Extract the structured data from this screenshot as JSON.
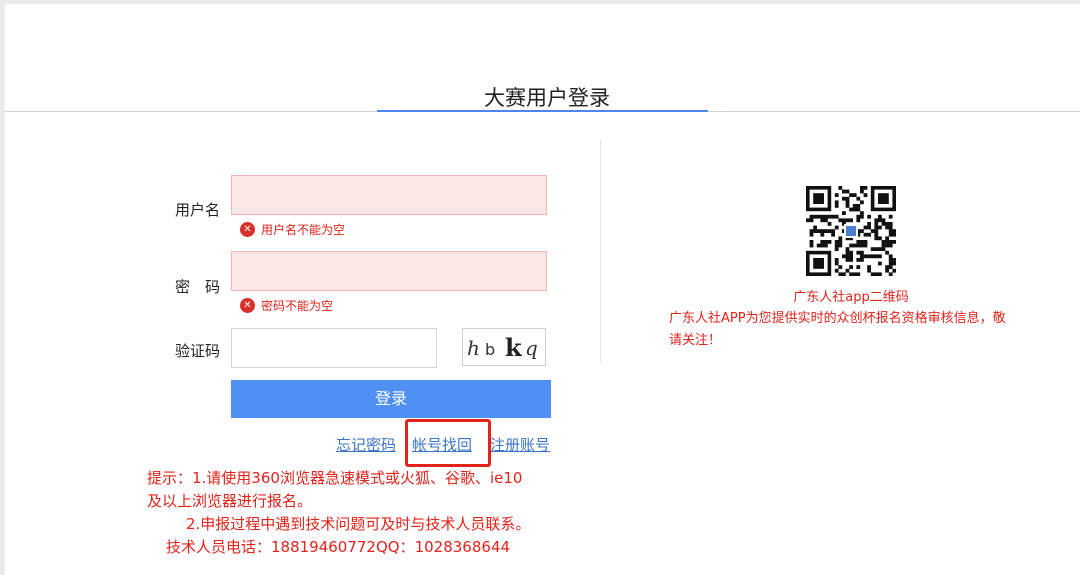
{
  "page_title": "大赛用户登录",
  "form": {
    "username_label": "用户名",
    "username_error": "用户名不能为空",
    "password_label": "密　码",
    "password_error": "密码不能为空",
    "captcha_label": "验证码",
    "captcha_text": "hbkq",
    "error_icon": "error-x-icon",
    "login_button": "登录"
  },
  "links": {
    "forgot_password": "忘记密码",
    "recover_account": "帐号找回",
    "register": "注册账号"
  },
  "tips": {
    "line1": "提示：1.请使用360浏览器急速模式或火狐、谷歌、ie10",
    "line2": "及以上浏览器进行报名。",
    "line3": "2.申报过程中遇到技术问题可及时与技术人员联系。",
    "line4": "技术人员电话：18819460772QQ：1028368644"
  },
  "qr": {
    "caption": "广东人社app二维码",
    "description": "广东人社APP为您提供实时的众创杯报名资格审核信息，敬请关注！"
  },
  "colors": {
    "accent": "#4f90f2",
    "error": "#e2231a",
    "link": "#3a73c9"
  }
}
